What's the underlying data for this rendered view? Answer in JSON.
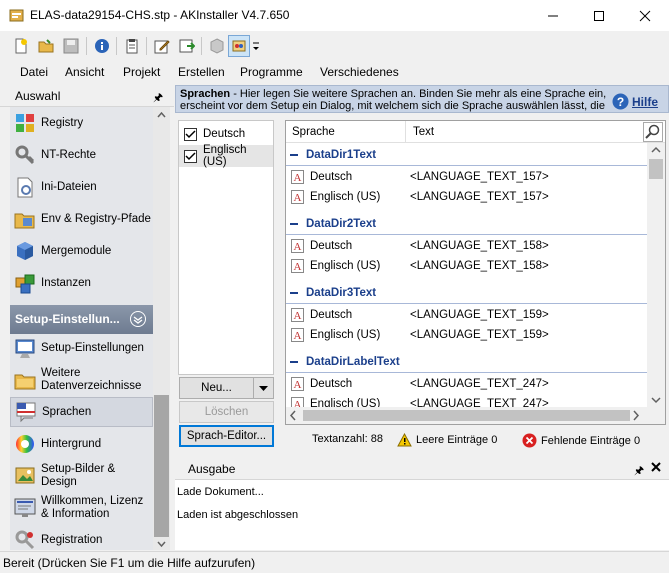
{
  "window": {
    "title": "ELAS-data29154-CHS.stp - AKInstaller V4.7.650"
  },
  "menu": [
    "Datei",
    "Ansicht",
    "Projekt",
    "Erstellen",
    "Programme",
    "Verschiedenes"
  ],
  "left_panel": {
    "title": "Auswahl",
    "items_top": [
      {
        "label": "Registry",
        "icon": "registry-icon"
      },
      {
        "label": "NT-Rechte",
        "icon": "nt-rights-icon"
      },
      {
        "label": "Ini-Dateien",
        "icon": "ini-files-icon"
      },
      {
        "label": "Env & Registry-Pfade",
        "icon": "env-registry-icon"
      },
      {
        "label": "Mergemodule",
        "icon": "merge-module-icon"
      },
      {
        "label": "Instanzen",
        "icon": "instances-icon"
      }
    ],
    "group_title": "Setup-Einstellun...",
    "items_group": [
      {
        "label": "Setup-Einstellungen",
        "icon": "setup-settings-icon"
      },
      {
        "label": "Weitere Datenverzeichnisse",
        "icon": "folders-icon"
      },
      {
        "label": "Sprachen",
        "icon": "languages-icon",
        "selected": true
      },
      {
        "label": "Hintergrund",
        "icon": "background-icon"
      },
      {
        "label": "Setup-Bilder & Design",
        "icon": "setup-images-icon"
      },
      {
        "label": "Willkommen, Lizenz & Information",
        "icon": "welcome-icon"
      },
      {
        "label": "Registration",
        "icon": "registration-icon"
      }
    ]
  },
  "banner": {
    "title": "Sprachen",
    "text": " - Hier legen Sie weitere Sprachen an. Binden Sie mehr als eine Sprache ein, erscheint vor dem Setup ein Dialog, mit welchem sich die Sprache auswählen lässt, die",
    "help_label": "Hilfe"
  },
  "languages": [
    {
      "label": "Deutsch",
      "checked": true
    },
    {
      "label": "Englisch (US)",
      "checked": true
    }
  ],
  "buttons": {
    "new_label": "Neu...",
    "delete_label": "Löschen",
    "editor_label": "Sprach-Editor..."
  },
  "grid": {
    "col_language": "Sprache",
    "col_text": "Text",
    "groups": [
      {
        "name": "DataDir1Text",
        "rows": [
          {
            "lang": "Deutsch",
            "text": "<LANGUAGE_TEXT_157>"
          },
          {
            "lang": "Englisch (US)",
            "text": "<LANGUAGE_TEXT_157>"
          }
        ]
      },
      {
        "name": "DataDir2Text",
        "rows": [
          {
            "lang": "Deutsch",
            "text": "<LANGUAGE_TEXT_158>"
          },
          {
            "lang": "Englisch (US)",
            "text": "<LANGUAGE_TEXT_158>"
          }
        ]
      },
      {
        "name": "DataDir3Text",
        "rows": [
          {
            "lang": "Deutsch",
            "text": "<LANGUAGE_TEXT_159>"
          },
          {
            "lang": "Englisch (US)",
            "text": "<LANGUAGE_TEXT_159>"
          }
        ]
      },
      {
        "name": "DataDirLabelText",
        "rows": [
          {
            "lang": "Deutsch",
            "text": "<LANGUAGE_TEXT_247>"
          },
          {
            "lang": "Englisch (US)",
            "text": "<LANGUAGE_TEXT_247>"
          }
        ]
      }
    ]
  },
  "grid_status": {
    "text_count": "Textanzahl: 88",
    "empty_entries": "Leere Einträge 0",
    "missing_entries": "Fehlende Einträge 0"
  },
  "output": {
    "title": "Ausgabe",
    "lines": [
      "Lade Dokument...",
      "Laden ist abgeschlossen"
    ]
  },
  "statusbar": {
    "text": "Bereit (Drücken Sie F1 um die Hilfe aufzurufen)"
  }
}
